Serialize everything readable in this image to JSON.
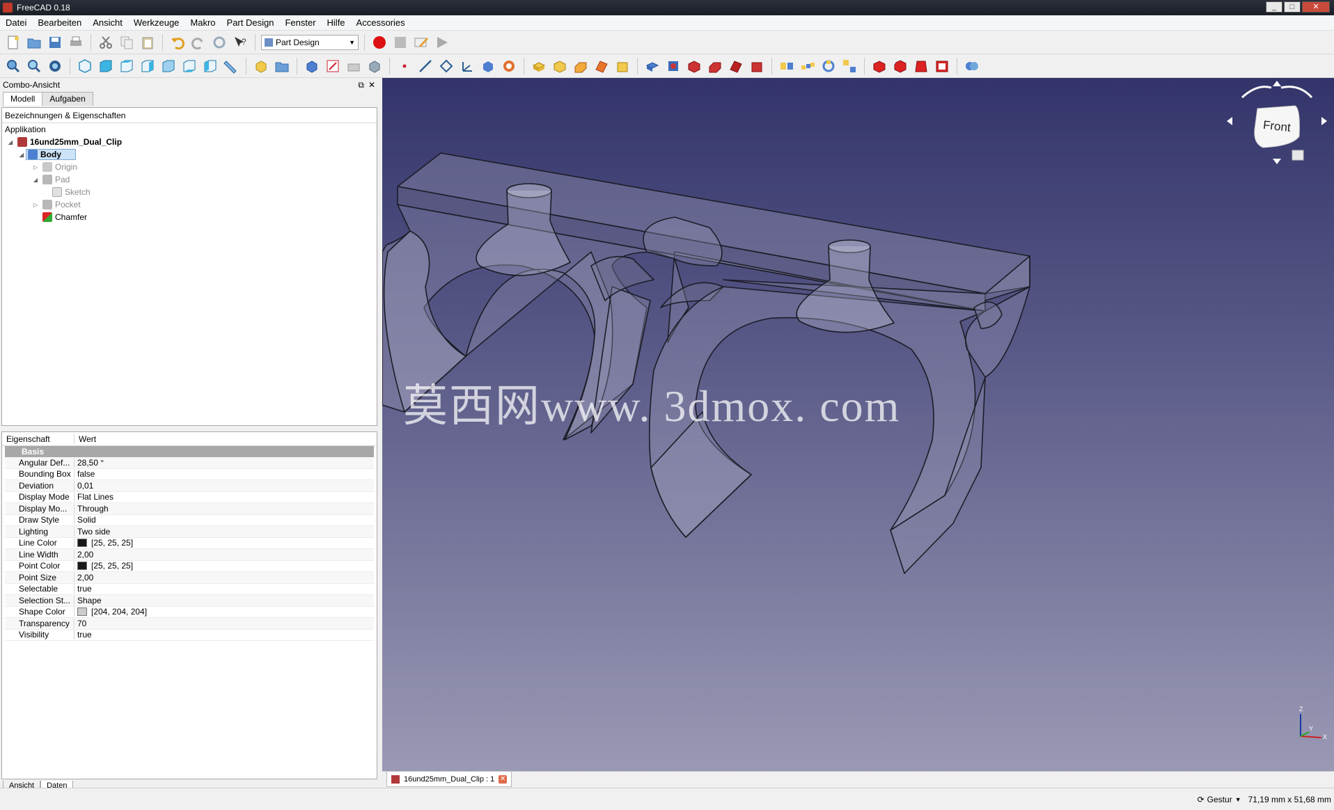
{
  "window": {
    "title": "FreeCAD 0.18"
  },
  "menubar": [
    "Datei",
    "Bearbeiten",
    "Ansicht",
    "Werkzeuge",
    "Makro",
    "Part Design",
    "Fenster",
    "Hilfe",
    "Accessories"
  ],
  "workbench": {
    "selected": "Part Design"
  },
  "combo": {
    "title": "Combo-Ansicht",
    "tabs": [
      "Modell",
      "Aufgaben"
    ],
    "tree_header": "Bezeichnungen & Eigenschaften",
    "tree": {
      "root_label": "Applikation",
      "document": "16und25mm_Dual_Clip",
      "body": "Body",
      "origin": "Origin",
      "pad": "Pad",
      "sketch": "Sketch",
      "pocket": "Pocket",
      "chamfer": "Chamfer"
    },
    "props_header": {
      "name": "Eigenschaft",
      "value": "Wert"
    },
    "group": "Basis",
    "properties": [
      {
        "name": "Angular Def...",
        "value": "28,50 °"
      },
      {
        "name": "Bounding Box",
        "value": "false"
      },
      {
        "name": "Deviation",
        "value": "0,01"
      },
      {
        "name": "Display Mode",
        "value": "Flat Lines"
      },
      {
        "name": "Display Mo...",
        "value": "Through"
      },
      {
        "name": "Draw Style",
        "value": "Solid"
      },
      {
        "name": "Lighting",
        "value": "Two side"
      },
      {
        "name": "Line Color",
        "value": "[25, 25, 25]",
        "swatch": "#191919"
      },
      {
        "name": "Line Width",
        "value": "2,00"
      },
      {
        "name": "Point Color",
        "value": "[25, 25, 25]",
        "swatch": "#191919"
      },
      {
        "name": "Point Size",
        "value": "2,00"
      },
      {
        "name": "Selectable",
        "value": "true"
      },
      {
        "name": "Selection St...",
        "value": "Shape"
      },
      {
        "name": "Shape Color",
        "value": "[204, 204, 204]",
        "swatch": "#cccccc"
      },
      {
        "name": "Transparency",
        "value": "70"
      },
      {
        "name": "Visibility",
        "value": "true"
      }
    ],
    "bottom_tabs": [
      "Ansicht",
      "Daten"
    ]
  },
  "view3d": {
    "watermark": "莫西网www. 3dmox. com",
    "navcube_face": "Front",
    "axis_labels": {
      "x": "X",
      "y": "Y",
      "z": "Z"
    },
    "tab_label": "16und25mm_Dual_Clip : 1"
  },
  "statusbar": {
    "nav_style": "Gestur",
    "dimensions": "71,19 mm x 51,68 mm"
  },
  "colors": {
    "accent_red": "#c0392b",
    "selection": "#cde3f7",
    "view_top": "#33346a",
    "view_bottom": "#9a99b4"
  }
}
